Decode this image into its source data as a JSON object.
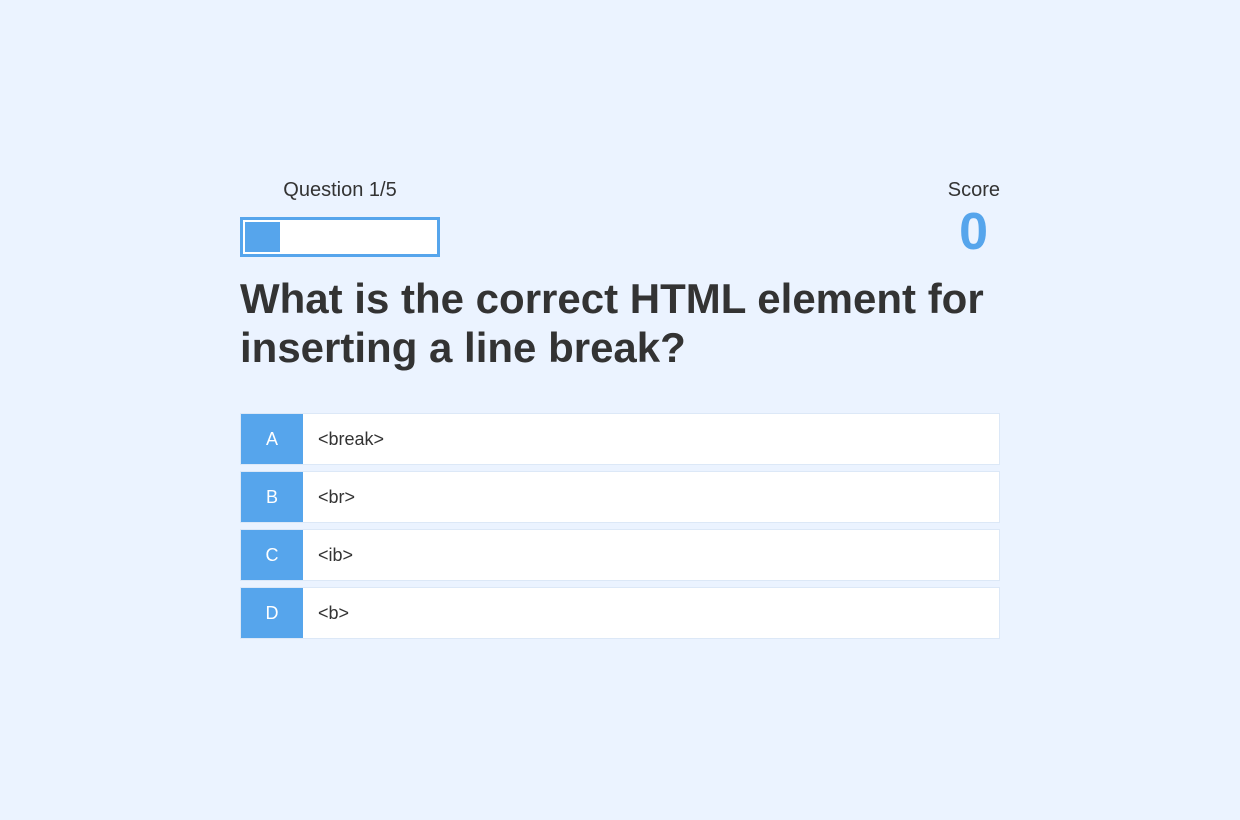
{
  "hud": {
    "progress_text": "Question 1/5",
    "progress_current": 1,
    "progress_total": 5,
    "score_label": "Score",
    "score_value": "0"
  },
  "question": "What is the correct HTML element for inserting a line break?",
  "choices": [
    {
      "prefix": "A",
      "text": "<break>"
    },
    {
      "prefix": "B",
      "text": "<br>"
    },
    {
      "prefix": "C",
      "text": "<ib>"
    },
    {
      "prefix": "D",
      "text": "<b>"
    }
  ],
  "colors": {
    "accent": "#56a5ec",
    "background": "#ebf3ff",
    "text": "#333333"
  }
}
